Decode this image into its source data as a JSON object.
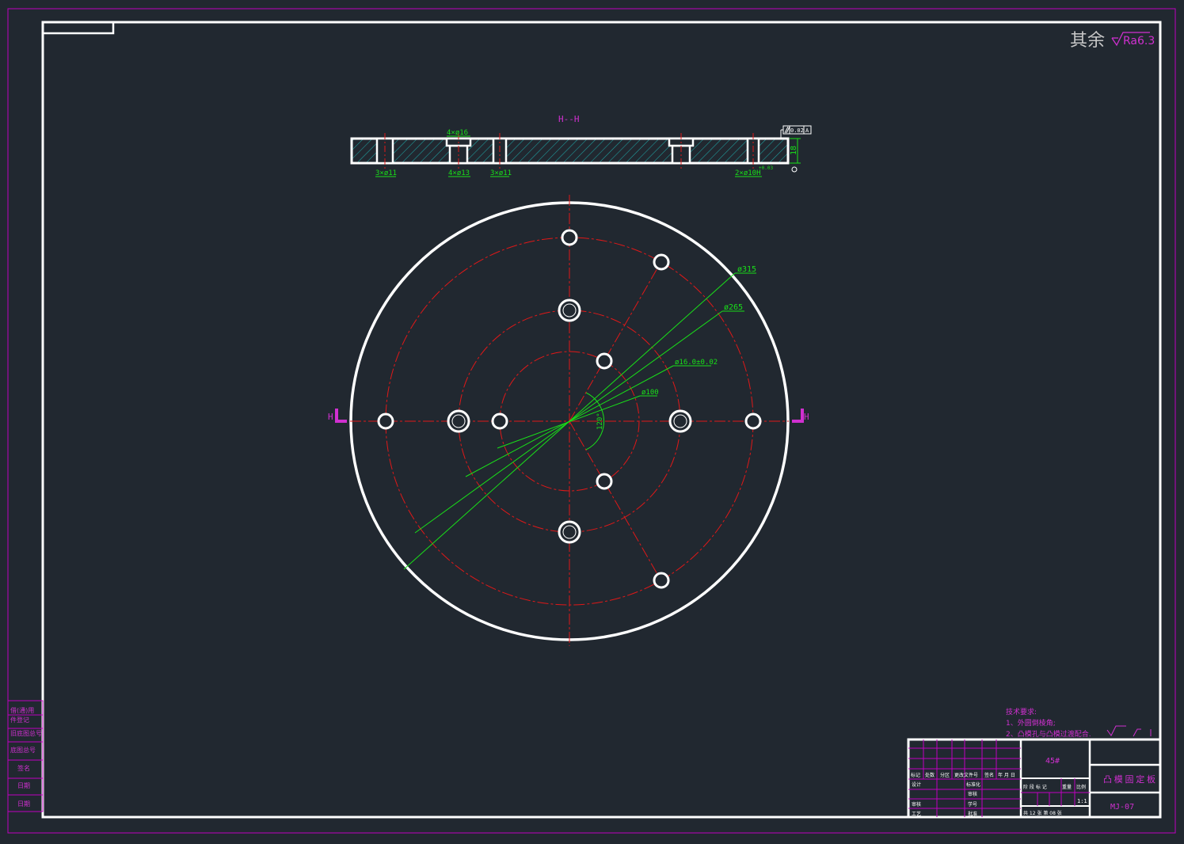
{
  "colors": {
    "background": "#212830",
    "outline": "#ffffff",
    "frame": "#c000c0",
    "centerline": "#e01818",
    "dimension": "#19e019",
    "hatch": "#1fa3a3",
    "annotation": "#d030d0"
  },
  "roughness": {
    "prefix": "其余",
    "value": "Ra6.3"
  },
  "section": {
    "title": "H--H",
    "callouts": {
      "top_counterbore": "4×ø16",
      "bottom_left": "3×ø11",
      "bottom_mid": "4×ø13",
      "bottom_mid2": "3×ø11",
      "bottom_right": "2×ø10H",
      "bottom_right_tol": "+0.03",
      "thickness": "18",
      "parallelism_value": "0.02",
      "parallelism_datum": "A"
    }
  },
  "plan": {
    "section_marker": "H",
    "dims": {
      "d315": "ø315",
      "d265": "ø265",
      "d16": "ø16.0±0.02",
      "d100": "ø100",
      "angle": "120°"
    }
  },
  "tech": {
    "title": "技术要求:",
    "line1": "1、外圆倒棱角;",
    "line2": "2、凸模孔与凸模过渡配合."
  },
  "left_strip": [
    "借(通)用",
    "件登记",
    "旧底图总号",
    "底图总号",
    "签名",
    "日期",
    "日期"
  ],
  "title_block": {
    "material": "45#",
    "part_name": "凸模固定板",
    "drawing_no": "MJ-07",
    "scale": "1:1",
    "header_labels": [
      "标记",
      "处数",
      "分区",
      "更改文件号",
      "签名",
      "年 月 日"
    ],
    "row_labels": [
      "设计",
      "审核",
      "工艺"
    ],
    "mid_labels": [
      "标准化",
      "审核",
      "学号",
      "批准"
    ],
    "stage_labels": [
      "阶 段 标 记",
      "重量",
      "比例"
    ],
    "sheet_text": "共 12 张   第 08 张"
  }
}
